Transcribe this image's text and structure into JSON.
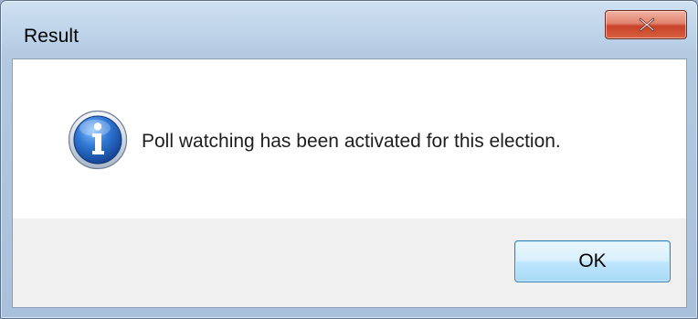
{
  "window": {
    "title": "Result",
    "close_icon": "close-x-icon"
  },
  "message": {
    "icon": "information-icon",
    "text": "Poll watching has been activated for this election."
  },
  "buttons": {
    "ok_label": "OK"
  },
  "colors": {
    "close_button": "#c8432a",
    "info_icon": "#1f5fb8",
    "ok_button_border": "#3c7fb1"
  }
}
